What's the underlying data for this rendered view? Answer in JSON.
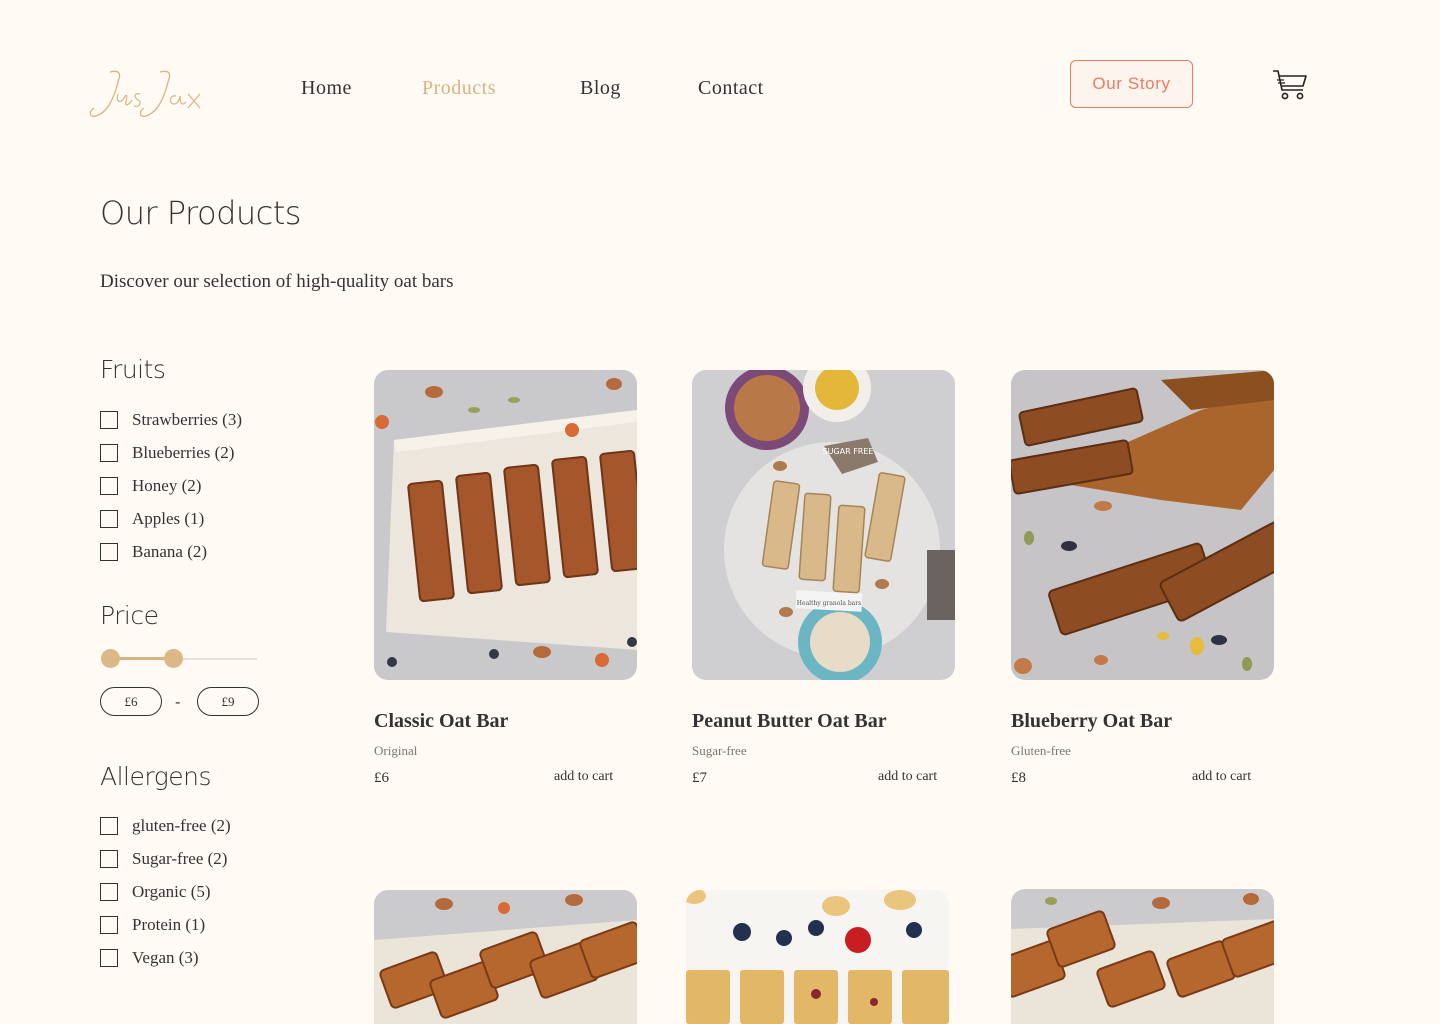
{
  "brand": {
    "logo_text": "JusJax",
    "logo_color": "#d8b482"
  },
  "nav": {
    "items": [
      {
        "label": "Home",
        "active": false
      },
      {
        "label": "Products",
        "active": true
      },
      {
        "label": "Blog",
        "active": false
      },
      {
        "label": "Contact",
        "active": false
      }
    ],
    "cta_label": "Our Story",
    "cart_icon": "cart-icon"
  },
  "page": {
    "title": "Our Products",
    "subtitle": "Discover our selection of high-quality oat bars"
  },
  "filters": {
    "fruits": {
      "title": "Fruits",
      "options": [
        "Strawberries (3)",
        "Blueberries (2)",
        "Honey (2)",
        "Apples (1)",
        "Banana (2)"
      ]
    },
    "price": {
      "title": "Price",
      "min_label": "£6",
      "max_label": "£9",
      "range_low_fraction": 0.0,
      "range_high_fraction": 0.43,
      "separator": "-"
    },
    "allergens": {
      "title": "Allergens",
      "options": [
        "gluten-free (2)",
        "Sugar-free (2)",
        "Organic (5)",
        "Protein (1)",
        "Vegan (3)"
      ]
    }
  },
  "products": [
    {
      "name": "Classic Oat Bar",
      "tag": "Original",
      "price": "£6",
      "cta": "add to cart"
    },
    {
      "name": "Peanut Butter Oat Bar",
      "tag": "Sugar-free",
      "price": "£7",
      "cta": "add to cart"
    },
    {
      "name": "Blueberry Oat Bar",
      "tag": "Gluten-free",
      "price": "£8",
      "cta": "add to cart"
    }
  ],
  "image_labels": {
    "sugar_free_sign": "SUGAR FREE",
    "card_note": "Healthy granola bars"
  },
  "colors": {
    "background": "#fffaf3",
    "accent": "#d8b482",
    "cta": "#ef7a62",
    "text": "#333333"
  }
}
